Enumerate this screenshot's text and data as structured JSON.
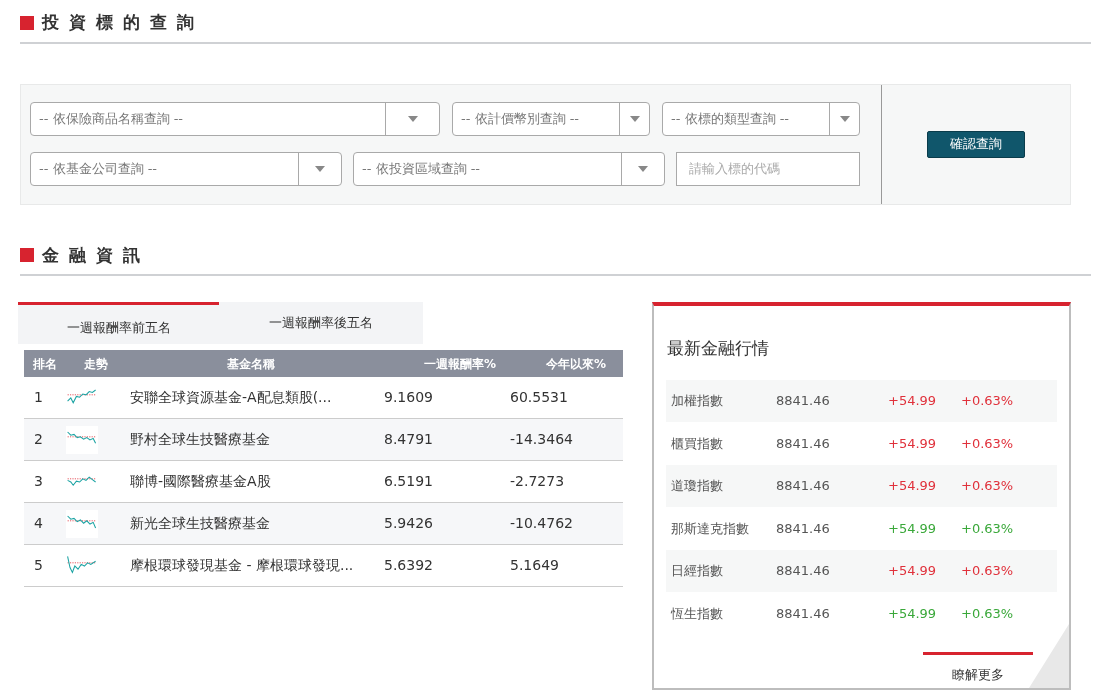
{
  "query_section": {
    "title": "投 資 標 的 查 詢",
    "selects_row_1": [
      {
        "placeholder": "-- 依保險商品名稱查詢 --"
      },
      {
        "placeholder": "-- 依計價幣別查詢 --"
      },
      {
        "placeholder": "-- 依標的類型查詢 --"
      }
    ],
    "selects_row_2": [
      {
        "placeholder": "-- 依基金公司查詢 --"
      },
      {
        "placeholder": "-- 依投資區域查詢 --"
      }
    ],
    "code_input": {
      "placeholder": "請輸入標的代碼"
    },
    "submit_button": "確認查詢"
  },
  "finance_section": {
    "title": "金 融 資 訊",
    "tabs": [
      {
        "label": "一週報酬率前五名",
        "selected": true
      },
      {
        "label": "一週報酬率後五名",
        "selected": false
      }
    ],
    "table": {
      "columns": [
        "排名",
        "走勢",
        "基金名稱",
        "一週報酬率%",
        "今年以來%"
      ],
      "rows": [
        {
          "rank": "1",
          "name": "安聯全球資源基金-A配息類股(...",
          "week": "9.1609",
          "ytd": "60.5531"
        },
        {
          "rank": "2",
          "name": "野村全球生技醫療基金",
          "week": "8.4791",
          "ytd": "-14.3464"
        },
        {
          "rank": "3",
          "name": "聯博-國際醫療基金A股",
          "week": "6.5191",
          "ytd": "-2.7273"
        },
        {
          "rank": "4",
          "name": "新光全球生技醫療基金",
          "week": "5.9426",
          "ytd": "-10.4762"
        },
        {
          "rank": "5",
          "name": "摩根環球發現基金 - 摩根環球發現...",
          "week": "5.6392",
          "ytd": "5.1649"
        }
      ]
    },
    "market_card": {
      "title": "最新金融行情",
      "rows": [
        {
          "name": "加權指數",
          "value": "8841.46",
          "change": "+54.99",
          "percent": "+0.63%",
          "color": "#e0313b"
        },
        {
          "name": "櫃買指數",
          "value": "8841.46",
          "change": "+54.99",
          "percent": "+0.63%",
          "color": "#e0313b"
        },
        {
          "name": "道瓊指數",
          "value": "8841.46",
          "change": "+54.99",
          "percent": "+0.63%",
          "color": "#e0313b"
        },
        {
          "name": "那斯達克指數",
          "value": "8841.46",
          "change": "+54.99",
          "percent": "+0.63%",
          "color": "#3aa83a"
        },
        {
          "name": "日經指數",
          "value": "8841.46",
          "change": "+54.99",
          "percent": "+0.63%",
          "color": "#e0313b"
        },
        {
          "name": "恆生指數",
          "value": "8841.46",
          "change": "+54.99",
          "percent": "+0.63%",
          "color": "#3aa83a"
        }
      ],
      "more_link": "瞭解更多"
    }
  }
}
